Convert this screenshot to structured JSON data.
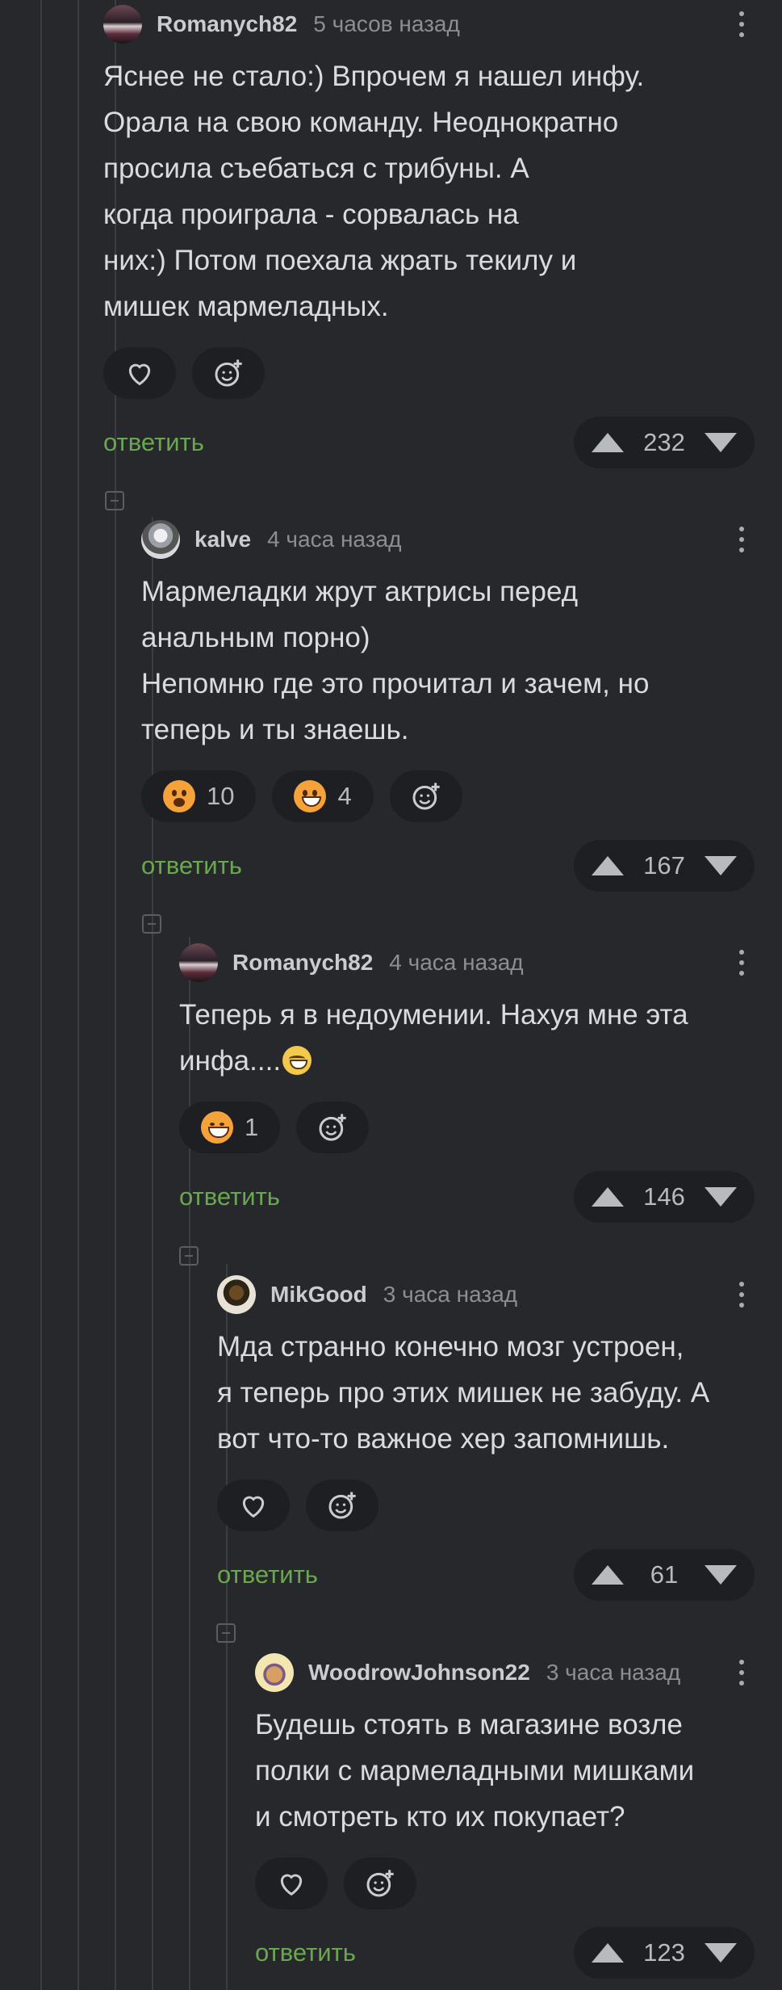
{
  "comments": [
    {
      "author": "Romanych82",
      "time": "5 часов назад",
      "text": "Яснее не стало:) Впрочем я нашел инфу.\nОрала на свою команду. Неоднократно\nпросила съебаться с трибуны. А\nкогда проиграла - сорвалась на\nних:) Потом поехала жрать текилу и\nмишек мармеладных.",
      "reactions": [],
      "reply": "ответить",
      "score": "232"
    },
    {
      "author": "kalve",
      "time": "4 часа назад",
      "text": "Мармеладки жрут актрисы перед\nанальным порно)\nНепомню где это прочитал и зачем, но\nтеперь и ты знаешь.",
      "reactions": [
        {
          "emoji": "shocked-face",
          "count": "10"
        },
        {
          "emoji": "grinning-face",
          "count": "4"
        }
      ],
      "reply": "ответить",
      "score": "167"
    },
    {
      "author": "Romanych82",
      "time": "4 часа назад",
      "text": "Теперь я в недоумении. Нахуя мне эта\nинфа....",
      "reactions": [
        {
          "emoji": "tears-of-joy-face",
          "count": "1"
        }
      ],
      "reply": "ответить",
      "score": "146"
    },
    {
      "author": "MikGood",
      "time": "3 часа назад",
      "text": "Мда странно конечно мозг устроен,\nя теперь про этих мишек не забуду. А\nвот что-то важное хер запомнишь.",
      "reactions": [],
      "reply": "ответить",
      "score": "61"
    },
    {
      "author": "WoodrowJohnson22",
      "time": "3 часа назад",
      "text": "Будешь стоять в магазине возле\nполки с мармеладными мишками\nи смотреть кто их покупает?",
      "reactions": [],
      "reply": "ответить",
      "score": "123"
    }
  ]
}
